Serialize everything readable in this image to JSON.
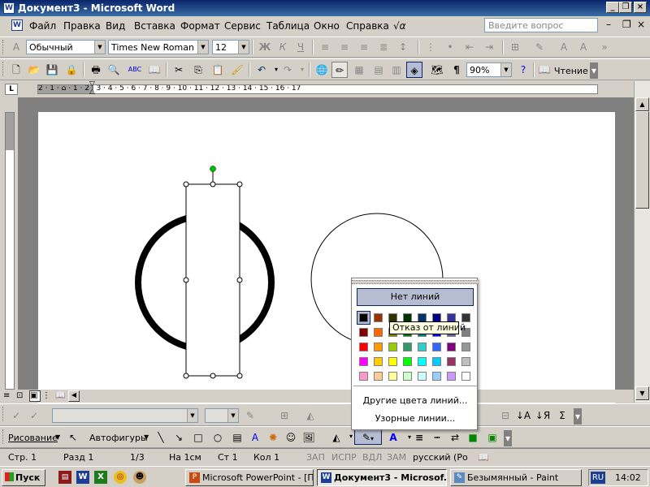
{
  "window": {
    "title": "Документ3 - Microsoft Word"
  },
  "menu": {
    "items": [
      "Файл",
      "Правка",
      "Вид",
      "Вставка",
      "Формат",
      "Сервис",
      "Таблица",
      "Окно",
      "Справка"
    ],
    "help_placeholder": "Введите вопрос"
  },
  "formatting": {
    "style": "Обычный",
    "font": "Times New Roman",
    "size": "12"
  },
  "standard": {
    "zoom": "90%",
    "reading_label": "Чтение"
  },
  "ruler": {
    "labels": "2 · 1 · ⌂ · 1 · 2 · 3 · 4 · 5 · 6 · 7 · 8 · 9 · 10 · 11 · 12 · 13 · 14 · 15 · 16 · 17"
  },
  "drawing": {
    "draw_menu": "Рисование",
    "autoshapes_menu": "Автофигуры"
  },
  "line_color_popup": {
    "no_lines": "Нет линий",
    "more_colors": "Другие цвета линий...",
    "patterned_lines": "Узорные линии...",
    "tooltip": "Отказ от линий",
    "swatches": [
      [
        "#000000",
        "#993300",
        "#333300",
        "#003300",
        "#003366",
        "#000080",
        "#333399",
        "#333333"
      ],
      [
        "#800000",
        "#ff6600",
        "#808000",
        "#008000",
        "#008080",
        "#0000ff",
        "#666699",
        "#808080"
      ],
      [
        "#ff0000",
        "#ff9900",
        "#99cc00",
        "#339966",
        "#33cccc",
        "#3366ff",
        "#800080",
        "#969696"
      ],
      [
        "#ff00ff",
        "#ffcc00",
        "#ffff00",
        "#00ff00",
        "#00ffff",
        "#00ccff",
        "#993366",
        "#c0c0c0"
      ],
      [
        "#ff99cc",
        "#ffcc99",
        "#ffff99",
        "#ccffcc",
        "#ccffff",
        "#99ccff",
        "#cc99ff",
        "#ffffff"
      ]
    ]
  },
  "status": {
    "page": "Стр. 1",
    "section": "Разд 1",
    "pages": "1/3",
    "at": "На 1см",
    "line": "Ст 1",
    "col": "Кол 1",
    "rec": "ЗАП",
    "trk": "ИСПР",
    "ext": "ВДЛ",
    "ovr": "ЗАМ",
    "lang": "русский (Ро"
  },
  "taskbar": {
    "start": "Пуск",
    "tasks": [
      "Microsoft PowerPoint - [П...",
      "Документ3 - Microsof...",
      "Безымянный - Paint"
    ],
    "lang_indicator": "RU",
    "time": "14:02"
  },
  "colors": {
    "title_bar": "#0a246a",
    "selection": "#b6bdd2",
    "handle_green": "#00c000"
  }
}
